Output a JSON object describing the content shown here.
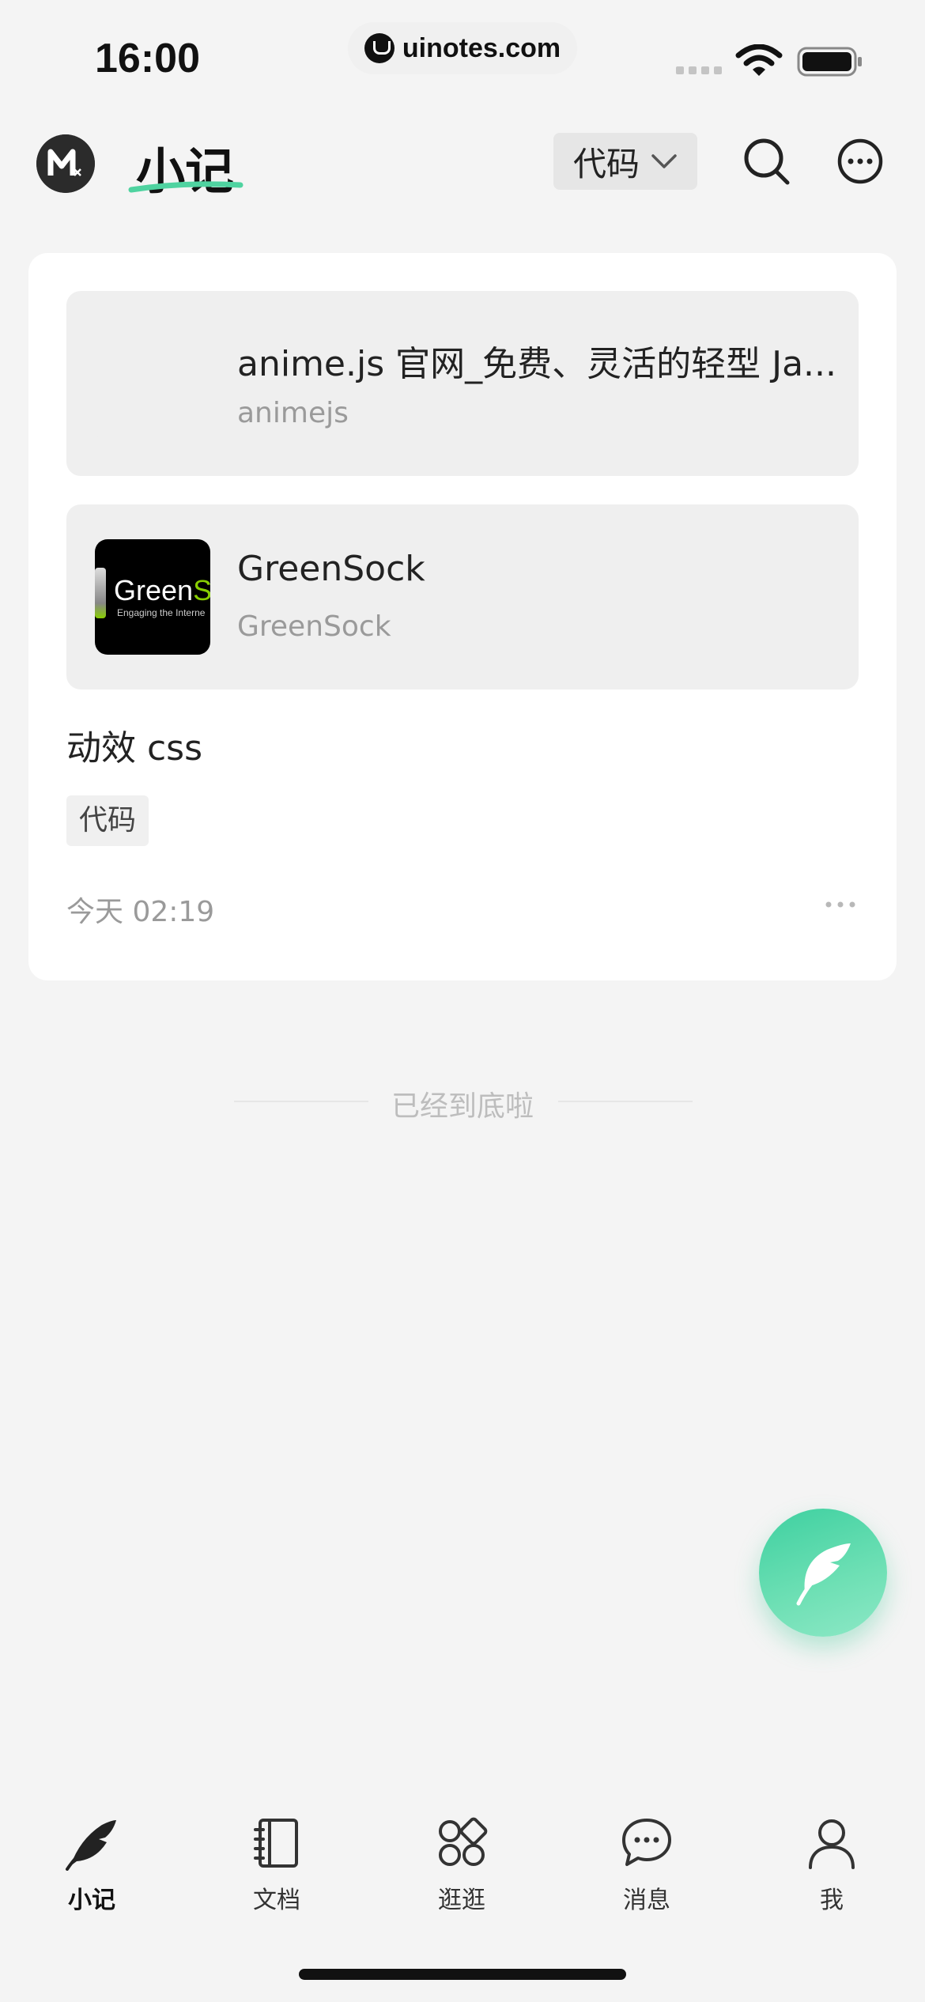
{
  "status_bar": {
    "time": "16:00",
    "url": "uinotes.com"
  },
  "header": {
    "title": "小记",
    "filter_label": "代码",
    "logo_icon": "app-logo-m-icon",
    "search_icon": "search-icon",
    "more_icon": "more-options-icon"
  },
  "note": {
    "links": [
      {
        "title": "anime.js 官网_免费、灵活的轻型 Ja...",
        "domain": "animejs"
      },
      {
        "title": "GreenSock",
        "domain": "GreenSock",
        "thumb_text_main": "Green",
        "thumb_text_accent": "Sc",
        "thumb_subtext": "Engaging the Interne"
      }
    ],
    "text": "动效 css",
    "tag": "代码",
    "time": "今天 02:19"
  },
  "end_of_list": "已经到底啦",
  "fab": {
    "icon": "feather-pen-icon",
    "colors": [
      "#3ed0a0",
      "#8de8c6"
    ]
  },
  "tabs": [
    {
      "label": "小记",
      "icon": "feather-icon",
      "active": true
    },
    {
      "label": "文档",
      "icon": "notebook-icon",
      "active": false
    },
    {
      "label": "逛逛",
      "icon": "explore-grid-icon",
      "active": false
    },
    {
      "label": "消息",
      "icon": "chat-bubble-icon",
      "active": false
    },
    {
      "label": "我",
      "icon": "user-icon",
      "active": false
    }
  ]
}
